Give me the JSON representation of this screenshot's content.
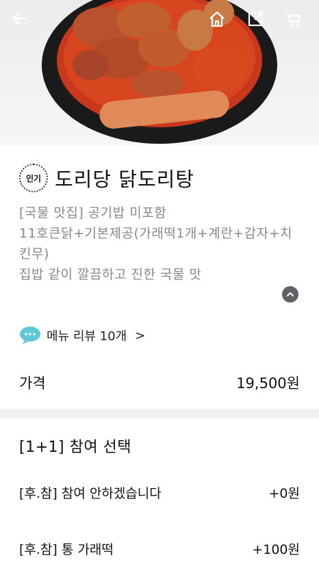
{
  "header": {
    "icons": [
      "arrow-left-icon",
      "home-icon",
      "share-icon",
      "cart-icon"
    ]
  },
  "product": {
    "badge": "인기",
    "name": "도리당 닭도리탕",
    "description_lines": [
      "[국물 맛집] 공기밥 미포함",
      "11호큰닭+기본제공(가래떡1개+계란+감자+치킨무)",
      "집밥 같이 깔끔하고 진한 국물 맛"
    ]
  },
  "review": {
    "label": "메뉴 리뷰 10개",
    "chevron": ">"
  },
  "price": {
    "label": "가격",
    "value": "19,500원"
  },
  "options": {
    "title": "[1+1] 참여 선택",
    "items": [
      {
        "label": "[후.참] 참여 안하겠습니다",
        "price": "+0원"
      },
      {
        "label": "[후.참] 통 가래떡",
        "price": "+100원"
      }
    ]
  },
  "colors": {
    "accent_chat": "#5ec8d6",
    "description_gray": "#888888",
    "divider": "#f1f1f1"
  }
}
